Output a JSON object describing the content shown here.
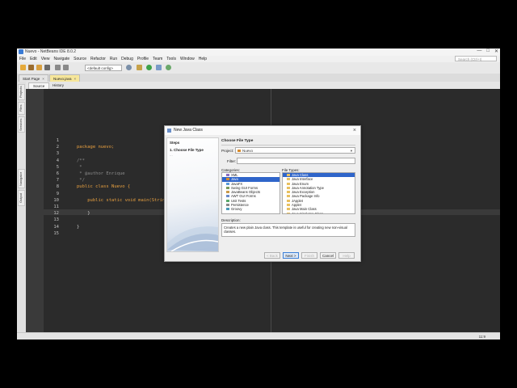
{
  "window": {
    "title": "Nuevo - NetBeans IDE 8.0.2"
  },
  "menu": [
    "File",
    "Edit",
    "View",
    "Navigate",
    "Source",
    "Refactor",
    "Run",
    "Debug",
    "Profile",
    "Team",
    "Tools",
    "Window",
    "Help"
  ],
  "search": {
    "placeholder": "Search (Ctrl+I)"
  },
  "toolbar": {
    "config": "<default config>"
  },
  "tabs": [
    {
      "label": "Start Page"
    },
    {
      "label": "Nuevo.java"
    }
  ],
  "editor_tabs": [
    {
      "label": "Source"
    },
    {
      "label": "History"
    }
  ],
  "sidebar_tabs": [
    "Projects",
    "Files",
    "Services",
    "Navigator",
    "Output"
  ],
  "editor": {
    "line_numbers": [
      "1",
      "2",
      "3",
      "4",
      "5",
      "6",
      "7",
      "8",
      "9",
      "10",
      "11",
      "12",
      "13",
      "14",
      "15"
    ],
    "lines": [
      "",
      "package nuevo;",
      "",
      "/**",
      " *",
      " * @author Enrique",
      " */",
      "public class Nuevo {",
      "",
      "    public static void main(String[] args) {",
      "",
      "    }",
      "",
      "}",
      ""
    ]
  },
  "statusbar": {
    "position": "11:9"
  },
  "dialog": {
    "title": "New Java Class",
    "steps_header": "Steps",
    "step1": "1.   Choose File Type",
    "step2": "...   ",
    "right_header": "Choose File Type",
    "project_label": "Project:",
    "project_value": "Nuevo",
    "filter_label": "Filter:",
    "categories_label": "Categories:",
    "file_types_label": "File Types:",
    "categories": [
      "XML",
      "Java",
      "JavaFX",
      "Swing GUI Forms",
      "JavaBeans Objects",
      "AWT GUI Forms",
      "Unit Tests",
      "Persistence",
      "Groovy"
    ],
    "file_types": [
      "Java Class",
      "Java Interface",
      "Java Enum",
      "Java Annotation Type",
      "Java Exception",
      "Java Package Info",
      "JApplet",
      "Applet",
      "Java Main Class",
      "Java Singleton Class"
    ],
    "description_label": "Description:",
    "description": "Creates a new plain Java class. This template is useful for creating new non-visual classes.",
    "buttons": {
      "back": "< Back",
      "next": "Next >",
      "finish": "Finish",
      "cancel": "Cancel",
      "help": "Help"
    }
  }
}
